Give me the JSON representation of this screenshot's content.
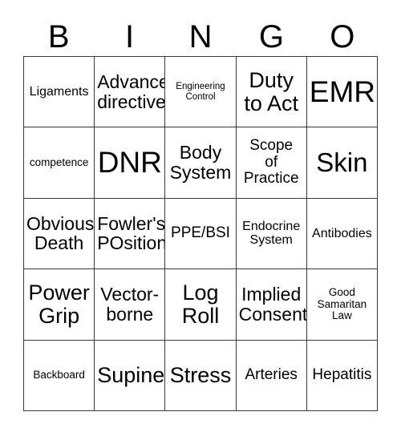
{
  "card": {
    "header_letters": [
      "B",
      "I",
      "N",
      "G",
      "O"
    ],
    "grid_rows": 5,
    "grid_cols": 5,
    "border_color": "#3a3a3a",
    "background_color": "#ffffff",
    "text_color": "#000000",
    "cells": [
      [
        {
          "text": "Ligaments",
          "size": "fs-md"
        },
        {
          "text": "Advance\ndirective",
          "size": "fs-xl"
        },
        {
          "text": "Engineering\nControl",
          "size": "fs-xs"
        },
        {
          "text": "Duty\nto Act",
          "size": "fs-2xl"
        },
        {
          "text": "EMR",
          "size": "fs-4xl"
        }
      ],
      [
        {
          "text": "competence",
          "size": "fs-sm"
        },
        {
          "text": "DNR",
          "size": "fs-4xl"
        },
        {
          "text": "Body\nSystem",
          "size": "fs-xl"
        },
        {
          "text": "Scope\nof\nPractice",
          "size": "fs-lg"
        },
        {
          "text": "Skin",
          "size": "fs-3xl"
        }
      ],
      [
        {
          "text": "Obvious\nDeath",
          "size": "fs-xl"
        },
        {
          "text": "Fowler's\nPOsition",
          "size": "fs-xl"
        },
        {
          "text": "PPE/BSI",
          "size": "fs-lg"
        },
        {
          "text": "Endocrine\nSystem",
          "size": "fs-md"
        },
        {
          "text": "Antibodies",
          "size": "fs-md"
        }
      ],
      [
        {
          "text": "Power\nGrip",
          "size": "fs-2xl"
        },
        {
          "text": "Vector-\nborne",
          "size": "fs-xl"
        },
        {
          "text": "Log\nRoll",
          "size": "fs-2xl"
        },
        {
          "text": "Implied\nConsent",
          "size": "fs-xl"
        },
        {
          "text": "Good\nSamaritan\nLaw",
          "size": "fs-sm"
        }
      ],
      [
        {
          "text": "Backboard",
          "size": "fs-sm"
        },
        {
          "text": "Supine",
          "size": "fs-2xl"
        },
        {
          "text": "Stress",
          "size": "fs-2xl"
        },
        {
          "text": "Arteries",
          "size": "fs-lg"
        },
        {
          "text": "Hepatitis",
          "size": "fs-lg"
        }
      ]
    ]
  }
}
